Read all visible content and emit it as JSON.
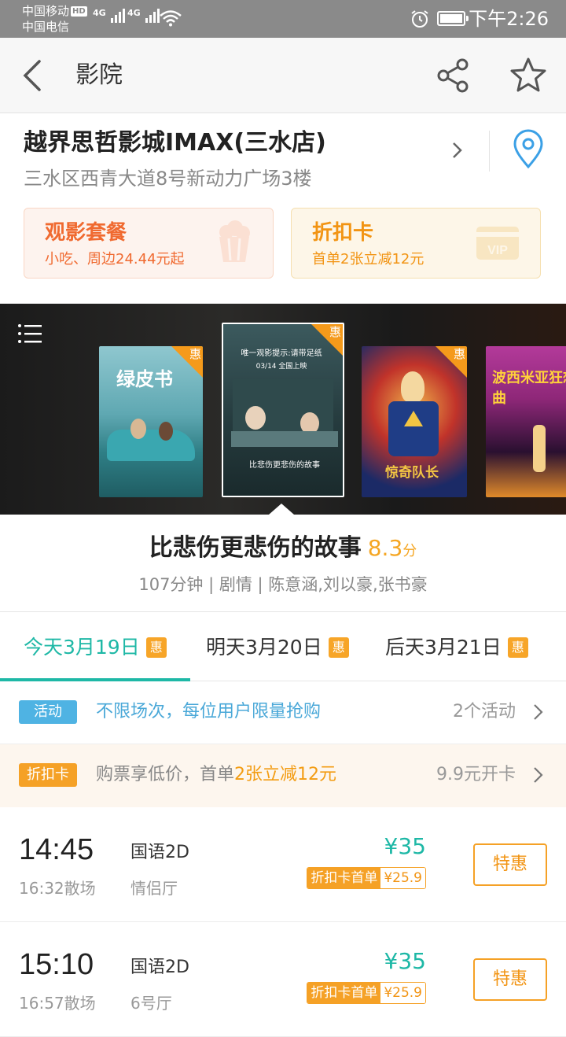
{
  "status_bar": {
    "carrier1": "中国移动",
    "hd": "HD",
    "carrier2": "中国电信",
    "net1": "4G",
    "net2": "4G",
    "time": "下午2:26"
  },
  "header": {
    "title": "影院"
  },
  "cinema": {
    "name": "越界思哲影城IMAX(三水店)",
    "address": "三水区西青大道8号新动力广场3楼",
    "promos": [
      {
        "title": "观影套餐",
        "subtitle": "小吃、周边24.44元起"
      },
      {
        "title": "折扣卡",
        "subtitle": "首单2张立减12元"
      }
    ]
  },
  "posters": [
    {
      "title": "绿皮书",
      "badge": "惠"
    },
    {
      "title": "比悲伤更悲伤的故事",
      "tagline": "唯一观影提示:请带足纸",
      "release": "03/14 全国上映",
      "badge": "惠"
    },
    {
      "title": "惊奇队长",
      "badge": "惠"
    },
    {
      "title": "波西米亚狂想曲",
      "badge": ""
    }
  ],
  "movie": {
    "title": "比悲伤更悲伤的故事",
    "score": "8.3",
    "score_unit": "分",
    "meta": "107分钟 | 剧情 | 陈意涵,刘以豪,张书豪"
  },
  "date_tabs": [
    {
      "label": "今天3月19日",
      "badge": "惠",
      "active": true
    },
    {
      "label": "明天3月20日",
      "badge": "惠",
      "active": false
    },
    {
      "label": "后天3月21日",
      "badge": "惠",
      "active": false
    }
  ],
  "activity": {
    "tag": "活动",
    "text": "不限场次，每位用户限量抢购",
    "right": "2个活动"
  },
  "discount_card": {
    "tag": "折扣卡",
    "text_prefix": "购票享低价，首单",
    "text_highlight": "2张立减12元",
    "right": "9.9元开卡"
  },
  "showtimes": [
    {
      "start": "14:45",
      "end": "16:32散场",
      "lang": "国语2D",
      "hall": "情侣厅",
      "price": "¥35",
      "card_label": "折扣卡首单",
      "card_price": "¥25.9",
      "button": "特惠"
    },
    {
      "start": "15:10",
      "end": "16:57散场",
      "lang": "国语2D",
      "hall": "6号厅",
      "price": "¥35",
      "card_label": "折扣卡首单",
      "card_price": "¥25.9",
      "button": "特惠"
    }
  ],
  "colors": {
    "accent_teal": "#1eb8a6",
    "accent_orange": "#f5a126",
    "promo_orange": "#f06a30",
    "link_blue": "#4aa8d8"
  }
}
